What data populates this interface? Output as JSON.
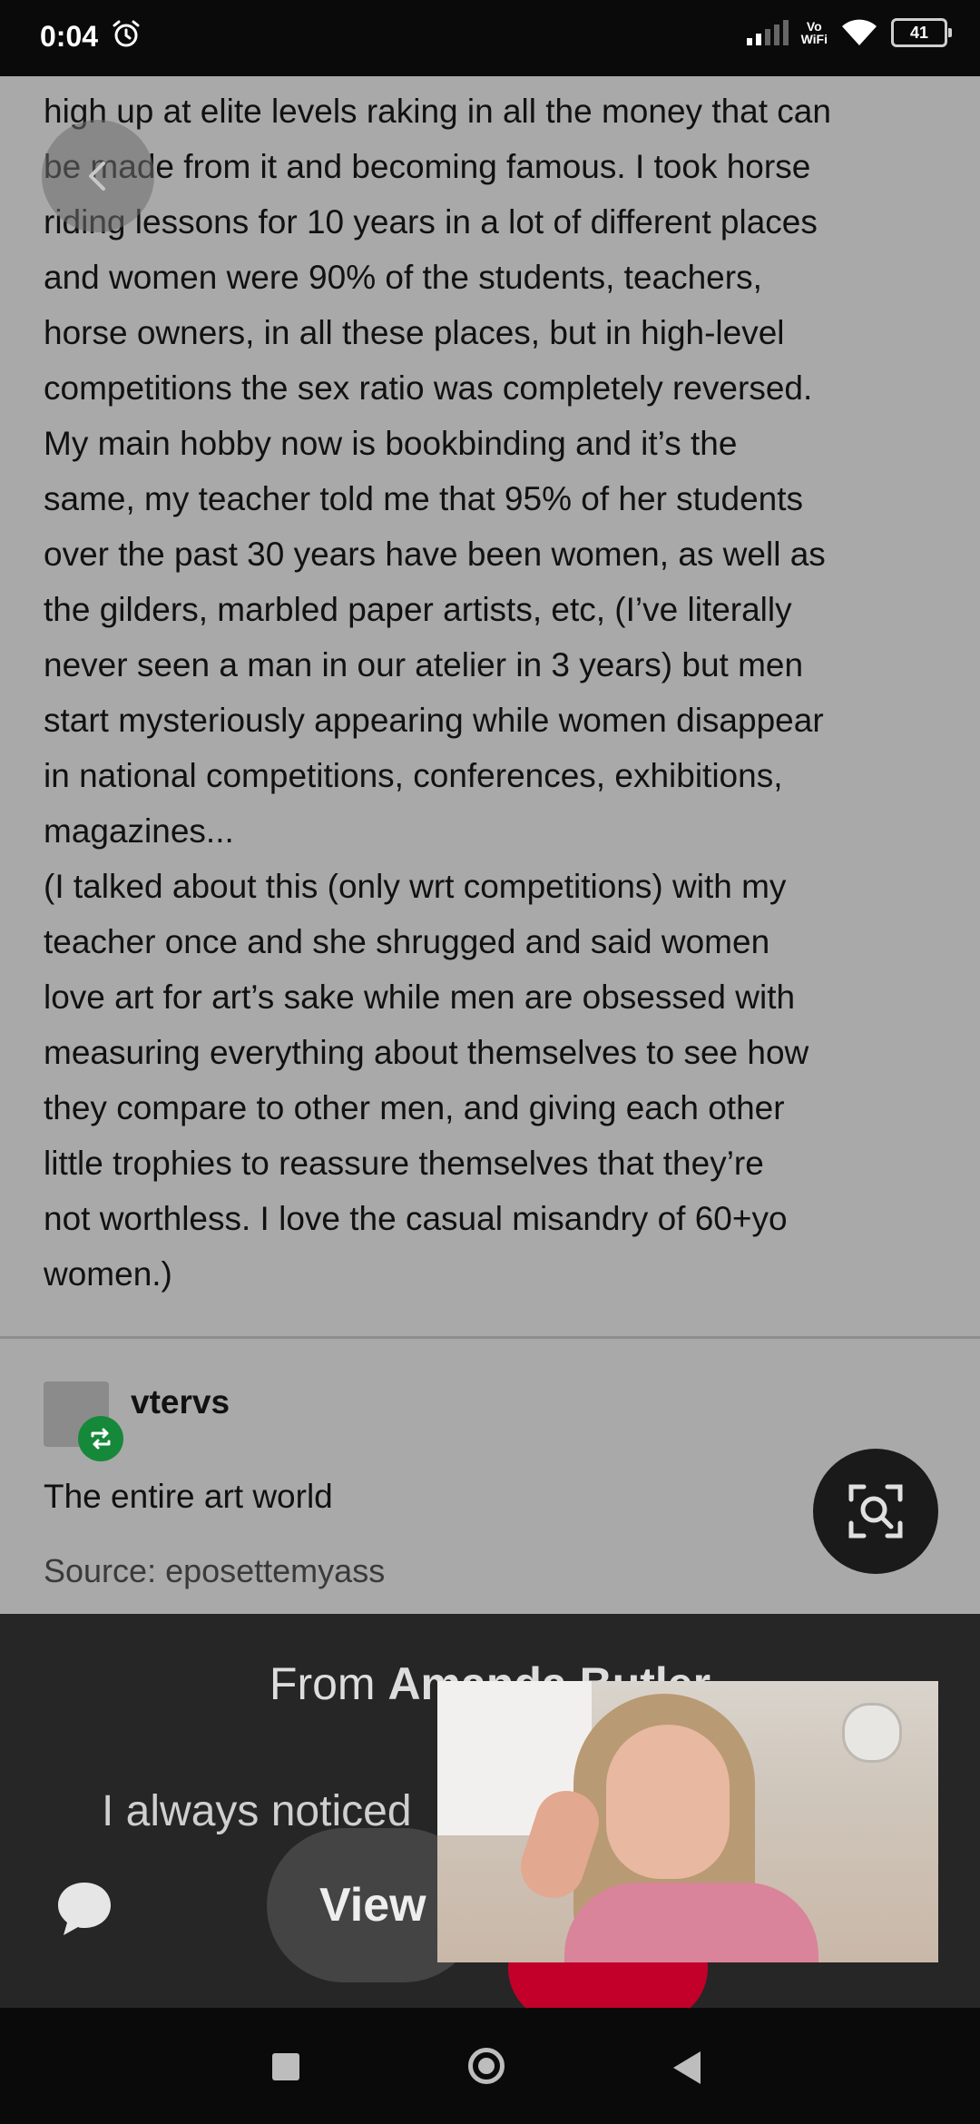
{
  "status_bar": {
    "time": "0:04",
    "vowifi_top": "Vo",
    "vowifi_bottom": "WiFi",
    "battery": "41"
  },
  "post": {
    "body_text": "high up at elite levels raking in all the money that can\nbe made from it and becoming famous. I took horse\nriding lessons for 10 years in a lot of different places\nand women were 90% of the students, teachers,\nhorse owners, in all these places, but in high-level\ncompetitions the sex ratio was completely reversed.\nMy main hobby now is bookbinding and it’s the\nsame, my teacher told me that 95% of her students\nover the past 30 years have been women, as well as\nthe gilders, marbled paper artists, etc, (I’ve literally\nnever seen a man in our atelier in 3 years) but men\nstart mysteriously appearing while women disappear\nin national competitions, conferences, exhibitions,\nmagazines...\n(I talked about this (only wrt competitions) with my\nteacher once and she shrugged and said women\nlove art for art’s sake while men are obsessed with\nmeasuring everything about themselves to see how\nthey compare to other men, and giving each other\nlittle trophies to reassure themselves that they’re\nnot worthless. I love the casual misandry of 60+yo\nwomen.)"
  },
  "reblog": {
    "username": "vtervs",
    "text": "The entire art world",
    "source": "Source: eposettemyass"
  },
  "sheet": {
    "title_prefix": "From ",
    "title_name": "Amanda Butler",
    "preview": "I always noticed",
    "view_label": "View"
  },
  "colors": {
    "page_dim": "#a9a9a9",
    "sheet_bg": "#262626",
    "reblog_green": "#16883a",
    "action_red": "#c2002a"
  },
  "icons": [
    "alarm-icon",
    "signal-icon",
    "wifi-icon",
    "battery-icon",
    "back-arrow-icon",
    "reblog-icon",
    "lens-search-icon",
    "chat-bubble-icon",
    "nav-recents-icon",
    "nav-home-icon",
    "nav-back-icon"
  ]
}
